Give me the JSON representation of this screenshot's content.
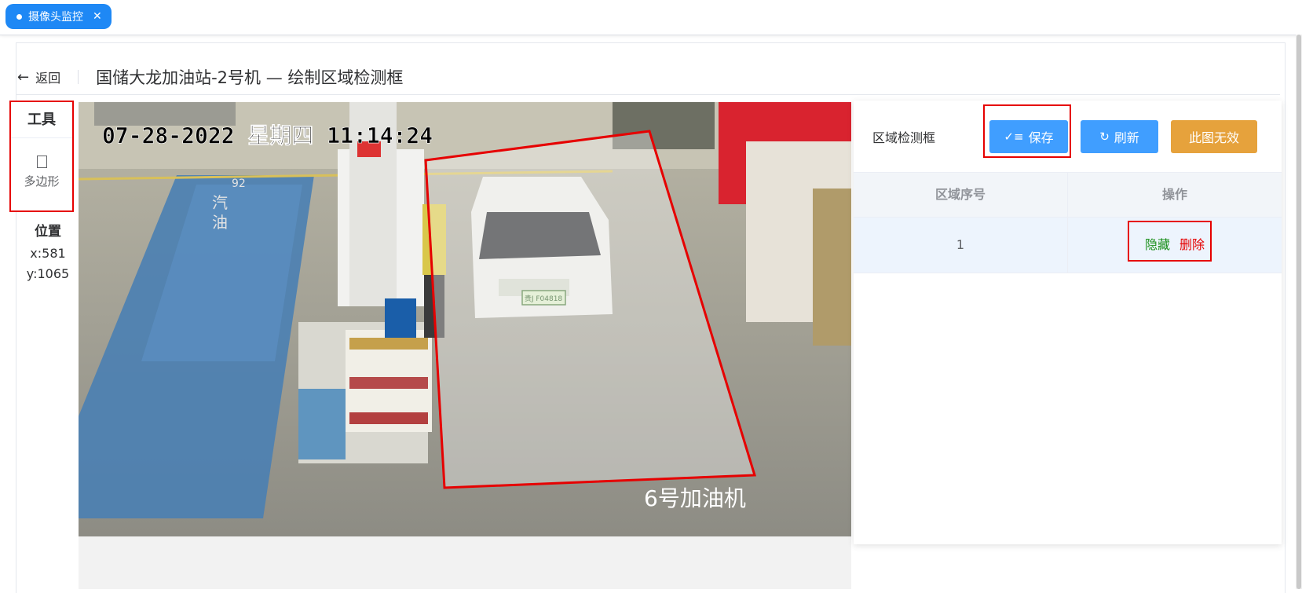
{
  "tab": {
    "label": "摄像头监控",
    "close": "✕"
  },
  "header": {
    "back_label": "返回",
    "back_arrow": "←",
    "title": "国储大龙加油站-2号机 — 绘制区域检测框"
  },
  "tools": {
    "title": "工具",
    "polygon_label": "多边形",
    "polygon_icon": "polygon-icon"
  },
  "position": {
    "title": "位置",
    "x": "x:581",
    "y": "y:1065"
  },
  "camera": {
    "timestamp": "07-28-2022 星期四 11:14:24",
    "pump_label": "6号加油机",
    "plate": "贵J F04818",
    "lane_text": [
      "92",
      "汽",
      "油"
    ]
  },
  "right_panel": {
    "label": "区域检测框",
    "save_label": "保存",
    "refresh_label": "刷新",
    "invalid_label": "此图无效",
    "columns": [
      "区域序号",
      "操作"
    ],
    "rows": [
      {
        "index": "1",
        "hide_label": "隐藏",
        "delete_label": "删除"
      }
    ]
  },
  "colors": {
    "primary": "#409eff",
    "warning": "#e6a23c",
    "highlight": "#e60000",
    "tab": "#1e88f5",
    "link_green": "#1a8f1a"
  }
}
